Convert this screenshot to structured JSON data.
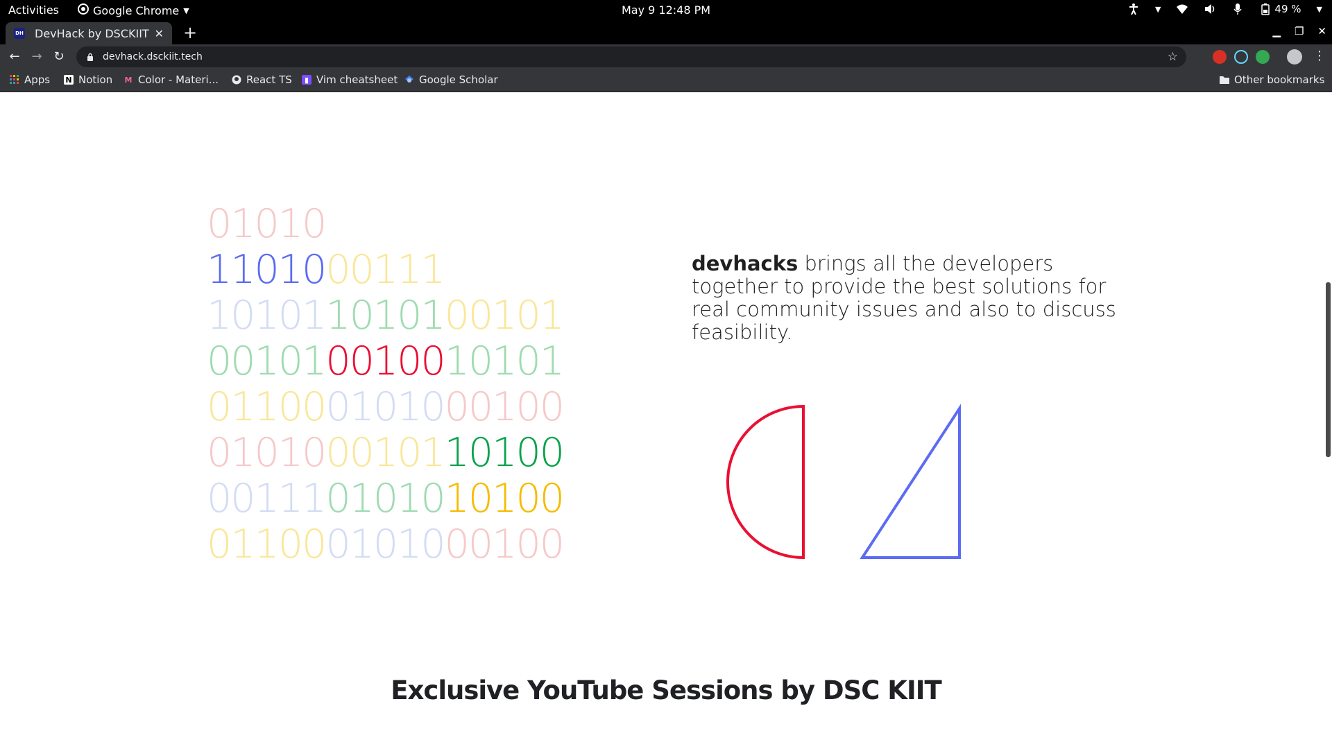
{
  "system_bar": {
    "activities": "Activities",
    "app_name": "Google Chrome",
    "clock": "May 9  12:48 PM",
    "battery": "49 %"
  },
  "browser": {
    "tab_title": "DevHack by DSCKIIT",
    "tab_favicon_text": "DH",
    "url": "devhack.dsckiit.tech",
    "bookmarks": [
      {
        "label": "Apps",
        "icon": "apps-grid-icon"
      },
      {
        "label": "Notion",
        "icon": "notion-icon"
      },
      {
        "label": "Color - Materi...",
        "icon": "material-icon"
      },
      {
        "label": "React TS",
        "icon": "github-icon"
      },
      {
        "label": "Vim cheatsheet",
        "icon": "vim-icon"
      },
      {
        "label": "Google Scholar",
        "icon": "scholar-icon"
      }
    ],
    "other_bookmarks": "Other bookmarks"
  },
  "page": {
    "binary_rows": [
      [
        {
          "text": "01010",
          "color": "#f6c9c9"
        }
      ],
      [
        {
          "text": "11010",
          "color": "#5c6cf2"
        },
        {
          "text": "00111",
          "color": "#f9e79a"
        }
      ],
      [
        {
          "text": "10101",
          "color": "#d3dcf5"
        },
        {
          "text": "10101",
          "color": "#9fdbb1"
        },
        {
          "text": "00101",
          "color": "#f9e79a"
        }
      ],
      [
        {
          "text": "00101",
          "color": "#9fdbb1"
        },
        {
          "text": "00100",
          "color": "#ea0f33"
        },
        {
          "text": "10101",
          "color": "#9fdbb1"
        }
      ],
      [
        {
          "text": "01100",
          "color": "#f9e79a"
        },
        {
          "text": "01010",
          "color": "#d3dcf5"
        },
        {
          "text": "00100",
          "color": "#f6c9c9"
        }
      ],
      [
        {
          "text": "01010",
          "color": "#f6c9c9"
        },
        {
          "text": "00101",
          "color": "#f9e79a"
        },
        {
          "text": "10100",
          "color": "#0aa24b"
        }
      ],
      [
        {
          "text": "00111",
          "color": "#d3dcf5"
        },
        {
          "text": "01010",
          "color": "#9fdbb1"
        },
        {
          "text": "10100",
          "color": "#f6bc00"
        }
      ],
      [
        {
          "text": "01100",
          "color": "#f9e79a"
        },
        {
          "text": "01010",
          "color": "#d3dcf5"
        },
        {
          "text": "00100",
          "color": "#f6c9c9"
        }
      ]
    ],
    "about_brand": "devhacks",
    "about_text": " brings all the developers together to provide the best solutions for real community issues and also to discuss feasibility.",
    "shape_colors": {
      "half_circle": "#ea0f33",
      "triangle": "#5c6cf2"
    },
    "section_title": "Exclusive YouTube Sessions by DSC KIIT"
  }
}
